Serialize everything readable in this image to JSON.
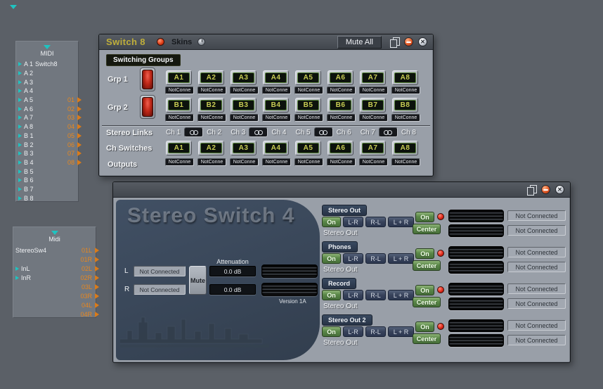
{
  "icons": {
    "close_glyph": "✕"
  },
  "midi_module": {
    "header": "MIDI",
    "rows": [
      {
        "port": "A 1",
        "label": "Switch8",
        "out": ""
      },
      {
        "port": "A 2",
        "label": "",
        "out": ""
      },
      {
        "port": "A 3",
        "label": "",
        "out": ""
      },
      {
        "port": "A 4",
        "label": "",
        "out": ""
      },
      {
        "port": "A 5",
        "label": "",
        "out": "01"
      },
      {
        "port": "A 6",
        "label": "",
        "out": "02"
      },
      {
        "port": "A 7",
        "label": "",
        "out": "03"
      },
      {
        "port": "A 8",
        "label": "",
        "out": "04"
      },
      {
        "port": "B 1",
        "label": "",
        "out": "05"
      },
      {
        "port": "B 2",
        "label": "",
        "out": "06"
      },
      {
        "port": "B 3",
        "label": "",
        "out": "07"
      },
      {
        "port": "B 4",
        "label": "",
        "out": "08"
      },
      {
        "port": "B 5",
        "label": "",
        "out": ""
      },
      {
        "port": "B 6",
        "label": "",
        "out": ""
      },
      {
        "port": "B 7",
        "label": "",
        "out": ""
      },
      {
        "port": "B 8",
        "label": "",
        "out": ""
      }
    ]
  },
  "stereo_module": {
    "header": "Midi",
    "rows": [
      {
        "left": "StereoSw4",
        "right": "01L"
      },
      {
        "left": "",
        "right": "01R"
      },
      {
        "left": "InL",
        "right": "02L"
      },
      {
        "left": "InR",
        "right": "02R"
      },
      {
        "left": "",
        "right": "03L"
      },
      {
        "left": "",
        "right": "03R"
      },
      {
        "left": "",
        "right": "04L"
      },
      {
        "left": "",
        "right": "04R"
      }
    ]
  },
  "switch8": {
    "title": "Switch 8",
    "skins_label": "Skins",
    "mute_all_label": "Mute All",
    "switching_groups_label": "Switching Groups",
    "grp1_label": "Grp 1",
    "grp2_label": "Grp 2",
    "grp1_buttons": [
      "A1",
      "A2",
      "A3",
      "A4",
      "A5",
      "A6",
      "A7",
      "A8"
    ],
    "grp1_connections": [
      "NotConne",
      "NotConne",
      "NotConne",
      "NotConne",
      "NotConne",
      "NotConne",
      "NotConne",
      "NotConne"
    ],
    "grp2_buttons": [
      "B1",
      "B2",
      "B3",
      "B4",
      "B5",
      "B6",
      "B7",
      "B8"
    ],
    "grp2_connections": [
      "NotConne",
      "NotConne",
      "NotConne",
      "NotConne",
      "NotConne",
      "NotConne",
      "NotConne",
      "NotConne"
    ],
    "stereo_links_label": "Stereo Links",
    "stereo_links": [
      {
        "ch_a": "Ch 1",
        "ch_b": "Ch 2"
      },
      {
        "ch_a": "Ch 3",
        "ch_b": "Ch 4"
      },
      {
        "ch_a": "Ch 5",
        "ch_b": "Ch 6"
      },
      {
        "ch_a": "Ch 7",
        "ch_b": "Ch 8"
      }
    ],
    "ch_switches_label": "Ch Switches",
    "ch_switch_buttons": [
      "A1",
      "A2",
      "A3",
      "A4",
      "A5",
      "A6",
      "A7",
      "A8"
    ],
    "outputs_label": "Outputs",
    "output_connections": [
      "NotConne",
      "NotConne",
      "NotConne",
      "NotConne",
      "NotConne",
      "NotConne",
      "NotConne",
      "NotConne"
    ]
  },
  "stereo_switch": {
    "watermark": "Stereo Switch 4",
    "input": {
      "l_label": "L",
      "r_label": "R",
      "l_value": "Not Connected",
      "r_value": "Not Connected",
      "mute_label": "Mute",
      "attenuation_label": "Attenuation",
      "atten_l": "0.0 dB",
      "atten_r": "0.0 dB",
      "version": "Version 1A"
    },
    "strips": [
      {
        "header": "Stereo Out",
        "on": "On",
        "lr": "L-R",
        "rl": "R-L",
        "lpr": "L + R",
        "on2": "On",
        "center": "Center",
        "out": "Stereo Out",
        "conn_l": "Not Connected",
        "conn_r": "Not Connected"
      },
      {
        "header": "Phones",
        "on": "On",
        "lr": "L-R",
        "rl": "R-L",
        "lpr": "L + R",
        "on2": "On",
        "center": "Center",
        "out": "Stereo Out",
        "conn_l": "Not Connected",
        "conn_r": "Not Connected"
      },
      {
        "header": "Record",
        "on": "On",
        "lr": "L-R",
        "rl": "R-L",
        "lpr": "L + R",
        "on2": "On",
        "center": "Center",
        "out": "Stereo Out",
        "conn_l": "Not Connected",
        "conn_r": "Not Connected"
      },
      {
        "header": "Stereo Out 2",
        "on": "On",
        "lr": "L-R",
        "rl": "R-L",
        "lpr": "L + R",
        "on2": "On",
        "center": "Center",
        "out": "Stereo Out",
        "conn_l": "Not Connected",
        "conn_r": "Not Connected"
      }
    ]
  }
}
